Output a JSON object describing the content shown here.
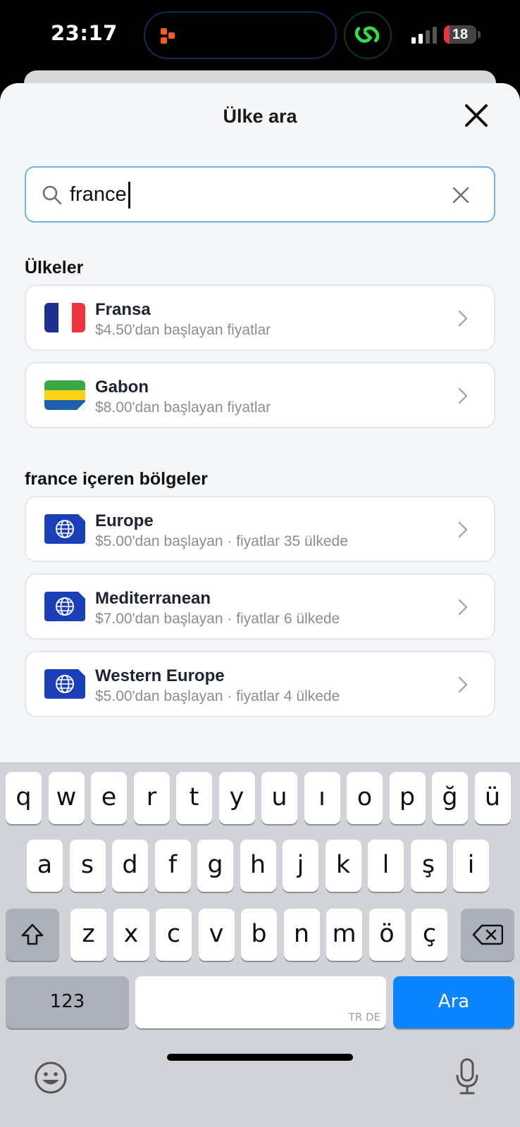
{
  "status": {
    "time": "23:17",
    "battery": "18",
    "battery_level": 0.18
  },
  "sheet": {
    "title": "Ülke ara"
  },
  "search": {
    "value": "france"
  },
  "countries": {
    "title": "Ülkeler",
    "items": [
      {
        "name": "Fransa",
        "subtitle": "$4.50'dan başlayan fiyatlar"
      },
      {
        "name": "Gabon",
        "subtitle": "$8.00'dan başlayan fiyatlar"
      }
    ]
  },
  "regions": {
    "title": "france içeren bölgeler",
    "items": [
      {
        "name": "Europe",
        "subtitle": "$5.00'dan başlayan · fiyatlar 35 ülkede"
      },
      {
        "name": "Mediterranean",
        "subtitle": "$7.00'dan başlayan · fiyatlar 6 ülkede"
      },
      {
        "name": "Western Europe",
        "subtitle": "$5.00'dan başlayan · fiyatlar 4 ülkede"
      }
    ]
  },
  "keyboard": {
    "row1": [
      "q",
      "w",
      "e",
      "r",
      "t",
      "y",
      "u",
      "ı",
      "o",
      "p",
      "ğ",
      "ü"
    ],
    "row2": [
      "a",
      "s",
      "d",
      "f",
      "g",
      "h",
      "j",
      "k",
      "l",
      "ş",
      "i"
    ],
    "row3": [
      "z",
      "x",
      "c",
      "v",
      "b",
      "n",
      "m",
      "ö",
      "ç"
    ],
    "numbers_label": "123",
    "space_hint": "TR DE",
    "go_label": "Ara"
  },
  "colors": {
    "accent": "#0a84ff",
    "search_border": "#6db4e8"
  }
}
